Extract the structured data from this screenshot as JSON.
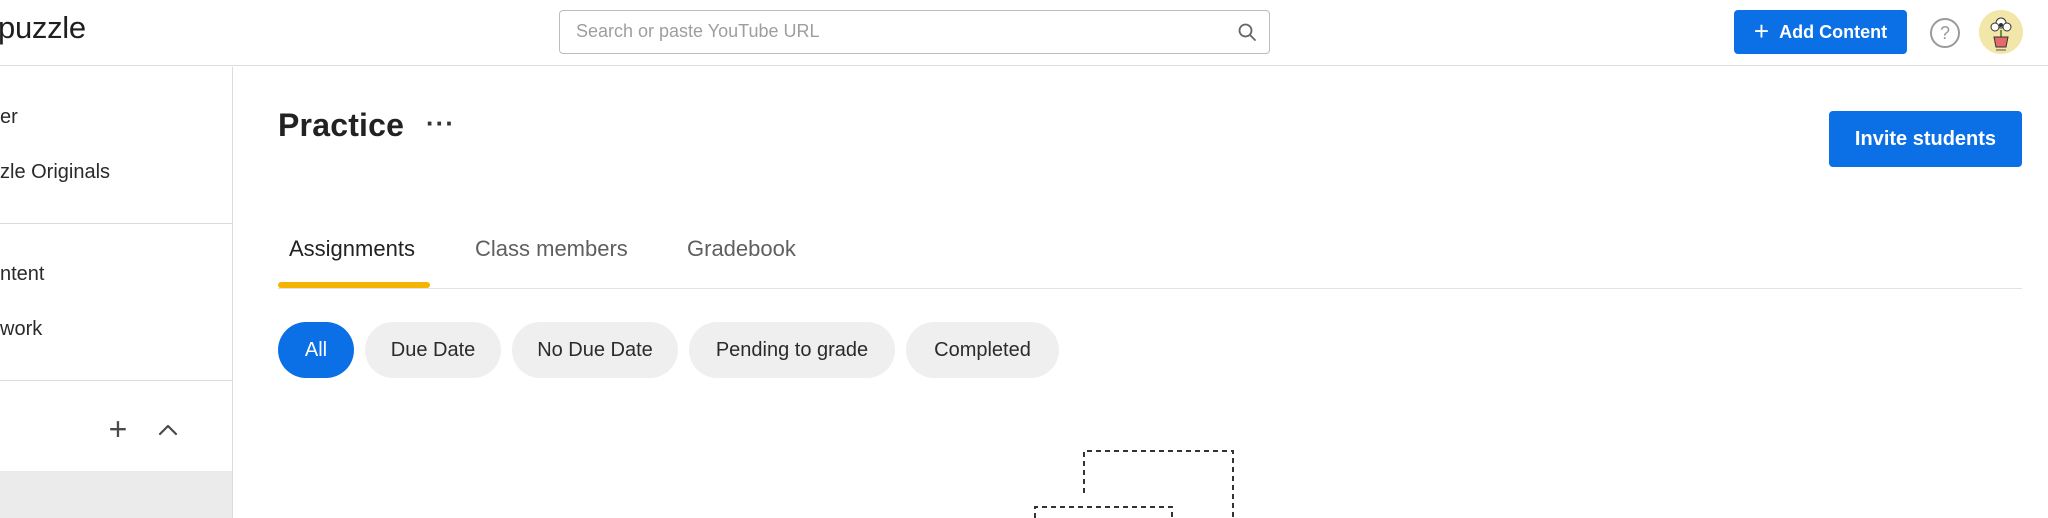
{
  "header": {
    "logo_text": "puzzle",
    "search": {
      "placeholder": "Search or paste YouTube URL",
      "value": ""
    },
    "add_content_label": "Add Content",
    "help_symbol": "?"
  },
  "sidebar": {
    "items": [
      {
        "label": "er"
      },
      {
        "label": "zle Originals"
      },
      {
        "label": "ntent"
      },
      {
        "label": "work"
      }
    ],
    "section_plus": "+"
  },
  "main": {
    "title": "Practice",
    "more_symbol": "···",
    "invite_label": "Invite students",
    "tabs": [
      {
        "label": "Assignments",
        "active": true
      },
      {
        "label": "Class members",
        "active": false
      },
      {
        "label": "Gradebook",
        "active": false
      }
    ],
    "filters": [
      {
        "label": "All",
        "active": true
      },
      {
        "label": "Due Date",
        "active": false
      },
      {
        "label": "No Due Date",
        "active": false
      },
      {
        "label": "Pending to grade",
        "active": false
      },
      {
        "label": "Completed",
        "active": false
      }
    ]
  },
  "colors": {
    "primary": "#0b6fe6",
    "tab_indicator": "#f5b400",
    "chip_bg": "#efefef",
    "divider": "#dcdcdc"
  },
  "icons": {
    "search": "search-icon",
    "add": "plus-icon",
    "help": "help-icon",
    "avatar": "avatar",
    "more": "more-icon",
    "collapse": "chevron-up-icon"
  }
}
